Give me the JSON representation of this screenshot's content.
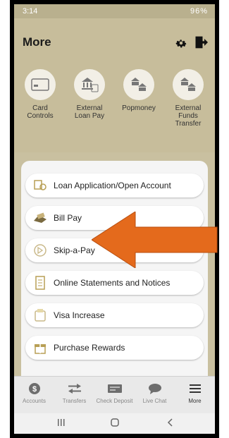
{
  "status": {
    "time": "3:14",
    "right": "96%"
  },
  "header": {
    "title": "More"
  },
  "tiles": [
    {
      "label": "Card\nControls"
    },
    {
      "label": "External\nLoan Pay"
    },
    {
      "label": "Popmoney"
    },
    {
      "label": "External\nFunds\nTransfer"
    }
  ],
  "menu": [
    {
      "label": "Loan Application/Open Account"
    },
    {
      "label": "Bill Pay"
    },
    {
      "label": "Skip-a-Pay"
    },
    {
      "label": "Online Statements and Notices"
    },
    {
      "label": "Visa Increase"
    },
    {
      "label": "Purchase Rewards"
    }
  ],
  "bottom_nav": [
    {
      "label": "Accounts"
    },
    {
      "label": "Transfers"
    },
    {
      "label": "Check Deposit"
    },
    {
      "label": "Live Chat"
    },
    {
      "label": "More"
    }
  ],
  "colors": {
    "accent": "#e46a1c",
    "header": "#c7bd9b"
  }
}
